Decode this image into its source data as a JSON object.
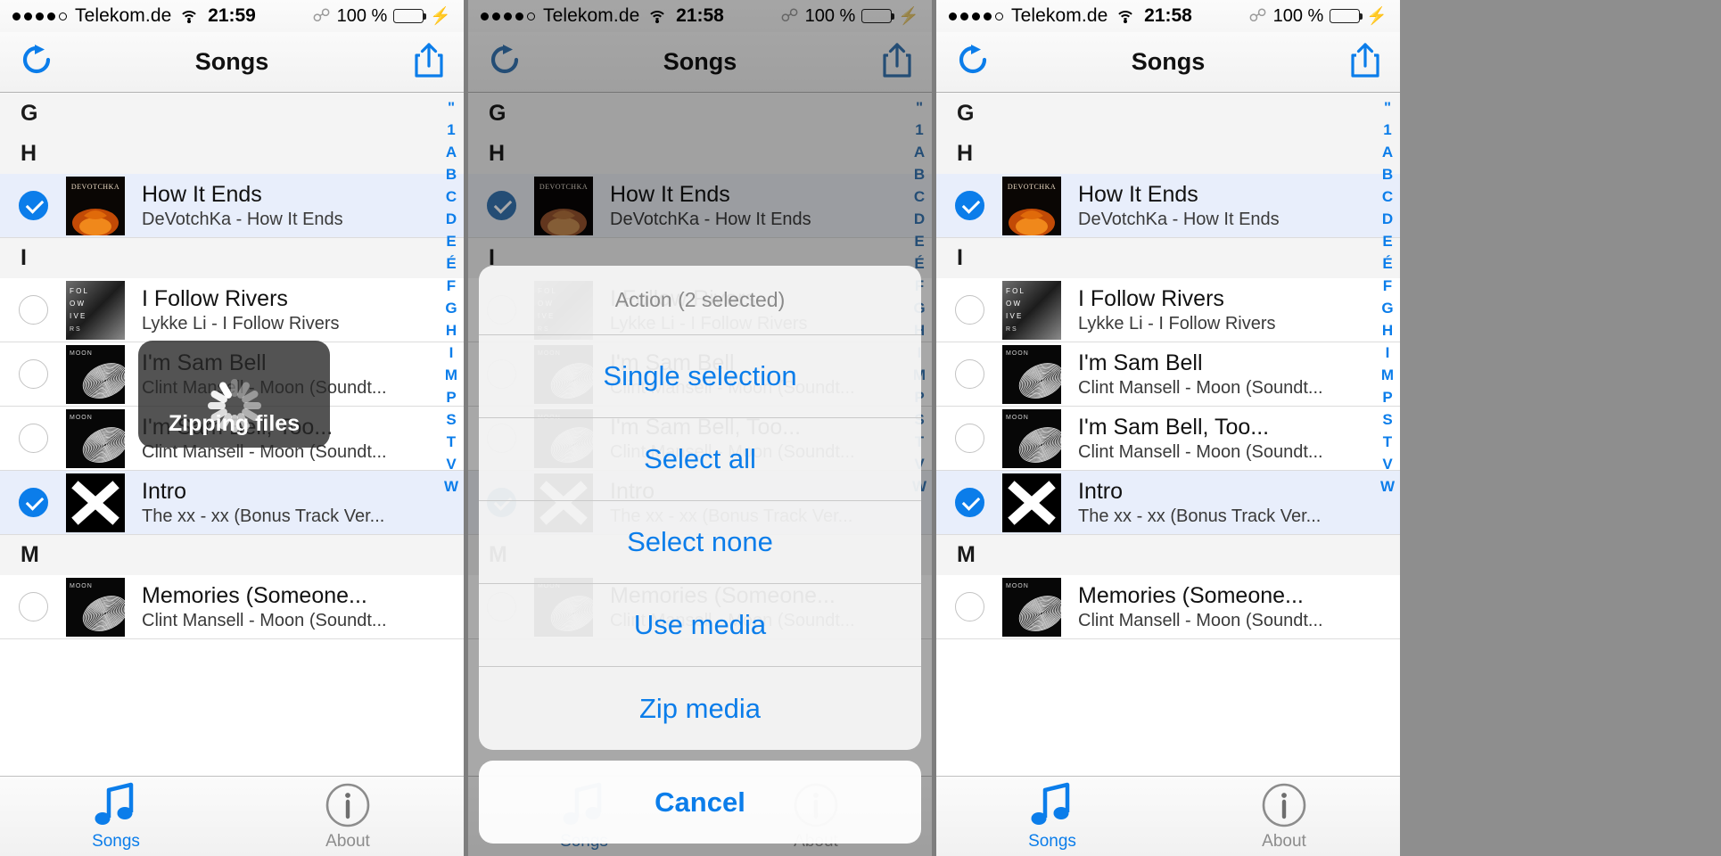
{
  "status_bar": {
    "signal_dots": 5,
    "signal_filled": 4,
    "carrier": "Telekom.de",
    "wifi_icon": "wifi-icon",
    "bluetooth_icon": "bluetooth-icon",
    "battery_percent": "100 %",
    "battery_color": "#4cd964",
    "charging_icon": "lightning-bolt-icon",
    "times": [
      "21:59",
      "21:58",
      "21:58"
    ]
  },
  "nav": {
    "title": "Songs",
    "left_icon": "refresh-icon",
    "right_icon": "share-icon",
    "accent": "#0b7dea"
  },
  "index_strip": [
    "\"",
    "1",
    "A",
    "B",
    "C",
    "D",
    "E",
    "É",
    "F",
    "G",
    "H",
    "I",
    "M",
    "P",
    "S",
    "T",
    "V",
    "W"
  ],
  "list": [
    {
      "type": "section",
      "label": "G"
    },
    {
      "type": "section",
      "label": "H"
    },
    {
      "type": "row",
      "selected": true,
      "art": "devotchka",
      "title": "How It Ends",
      "subtitle": "DeVotchKa - How It Ends"
    },
    {
      "type": "section",
      "label": "I"
    },
    {
      "type": "row",
      "selected": false,
      "art": "ifollowrivers",
      "title": "I Follow Rivers",
      "subtitle": "Lykke Li - I Follow Rivers"
    },
    {
      "type": "row",
      "selected": false,
      "art": "moon",
      "title": "I'm Sam Bell",
      "subtitle": "Clint Mansell - Moon (Soundt..."
    },
    {
      "type": "row",
      "selected": false,
      "art": "moon",
      "title": "I'm Sam Bell, Too...",
      "subtitle": "Clint Mansell - Moon (Soundt..."
    },
    {
      "type": "row",
      "selected": true,
      "art": "thexx",
      "title": "Intro",
      "subtitle": "The xx - xx (Bonus Track Ver..."
    },
    {
      "type": "section",
      "label": "M"
    },
    {
      "type": "row",
      "selected": false,
      "art": "moon",
      "title": "Memories (Someone...",
      "subtitle": "Clint Mansell - Moon (Soundt..."
    }
  ],
  "tabbar": {
    "tabs": [
      {
        "label": "Songs",
        "icon": "music-note-icon",
        "active": true
      },
      {
        "label": "About",
        "icon": "info-circle-icon",
        "active": false
      }
    ]
  },
  "toast": {
    "label": "Zipping files",
    "spinner_icon": "activity-spinner-icon"
  },
  "action_sheet": {
    "header": "Action (2 selected)",
    "items": [
      "Single selection",
      "Select all",
      "Select none",
      "Use media",
      "Zip media"
    ],
    "cancel": "Cancel"
  }
}
